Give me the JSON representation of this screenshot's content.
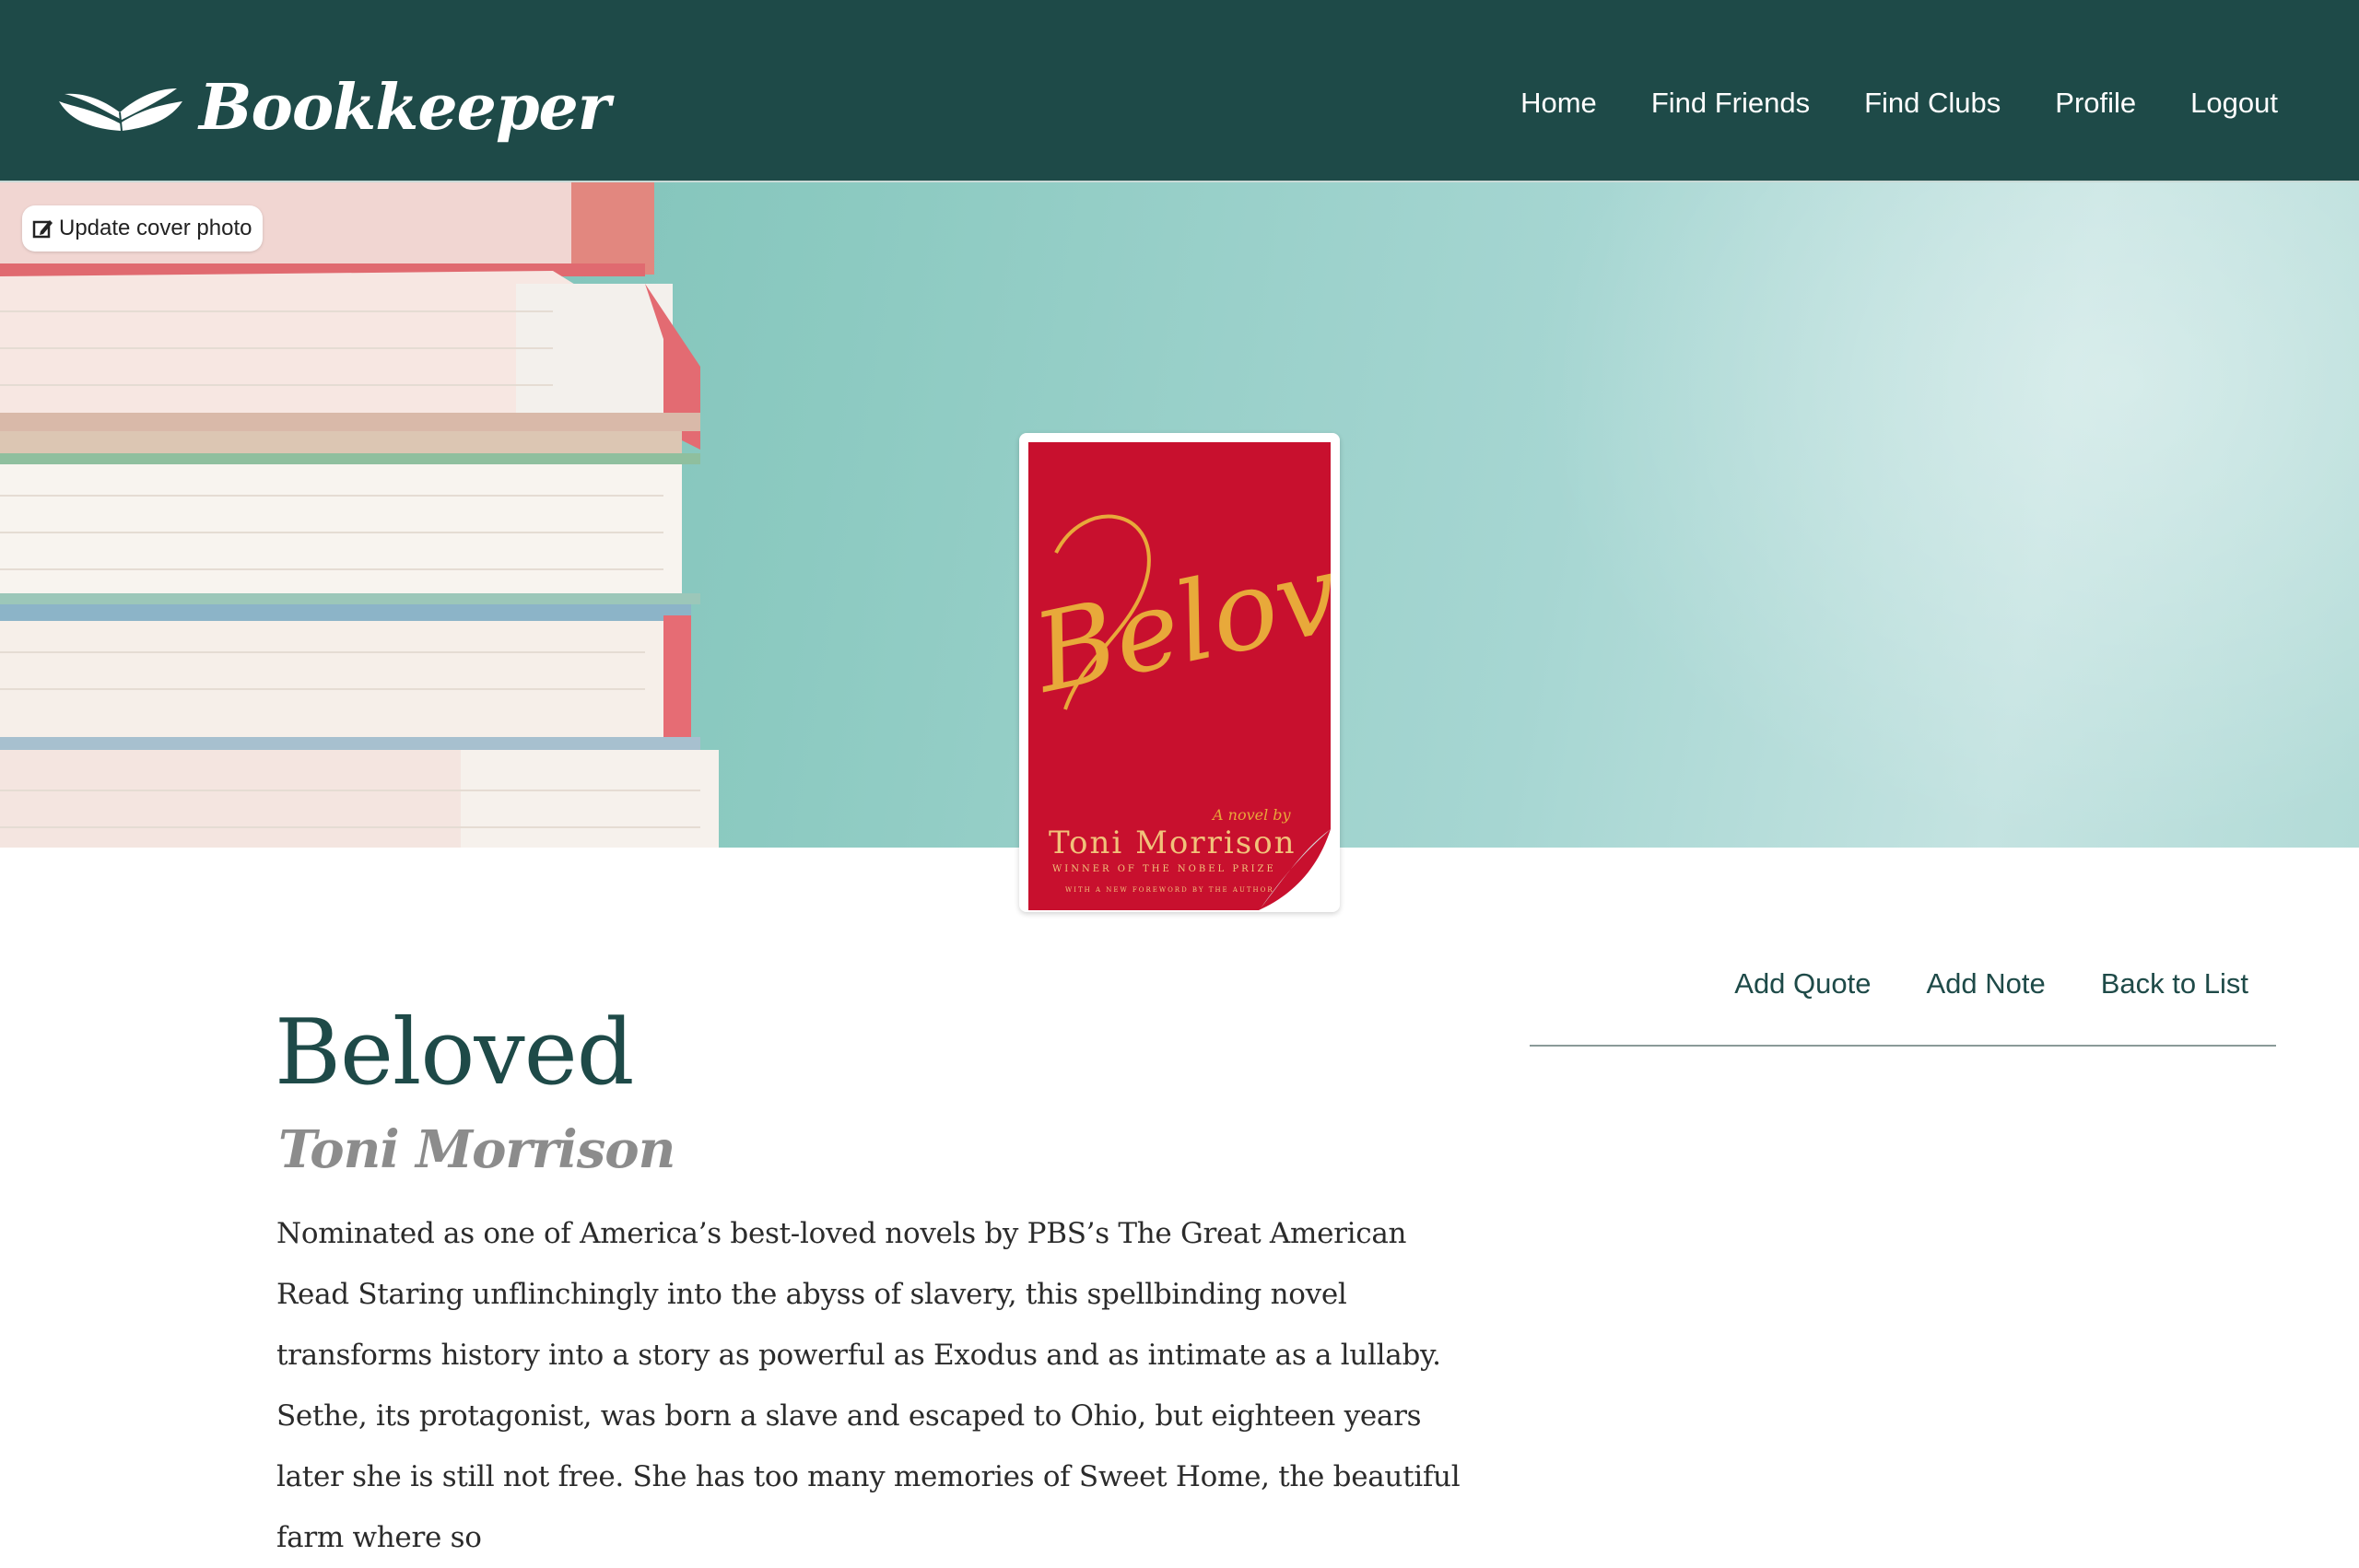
{
  "brand": {
    "name": "Bookkeeper"
  },
  "nav": {
    "items": [
      {
        "label": "Home"
      },
      {
        "label": "Find Friends"
      },
      {
        "label": "Find Clubs"
      },
      {
        "label": "Profile"
      },
      {
        "label": "Logout"
      }
    ]
  },
  "hero": {
    "update_cover_label": "Update cover photo",
    "update_cover_icon": "edit-icon"
  },
  "cover": {
    "title_art": "Beloved",
    "byline": "A novel by",
    "author_art": "Toni Morrison",
    "tagline": "WINNER OF THE NOBEL PRIZE",
    "subtagline": "WITH A NEW FOREWORD BY THE AUTHOR",
    "color": "#c8102e",
    "title_color": "#e8a93a"
  },
  "actions": {
    "add_quote": "Add Quote",
    "add_note": "Add Note",
    "back_to_list": "Back to List"
  },
  "book": {
    "title": "Beloved",
    "author": "Toni Morrison",
    "description": "Nominated as one of America’s best-loved novels by PBS’s The Great American Read Staring unflinchingly into the abyss of slavery, this spellbinding novel transforms history into a story as powerful as Exodus and as intimate as a lullaby. Sethe, its protagonist, was born a slave and escaped to Ohio, but eighteen years later she is still not free. She has too many memories of Sweet Home, the beautiful farm where so"
  },
  "colors": {
    "primary": "#1e4a48",
    "hero_teal": "#8ccac1",
    "muted_text": "#8c8c8c"
  }
}
